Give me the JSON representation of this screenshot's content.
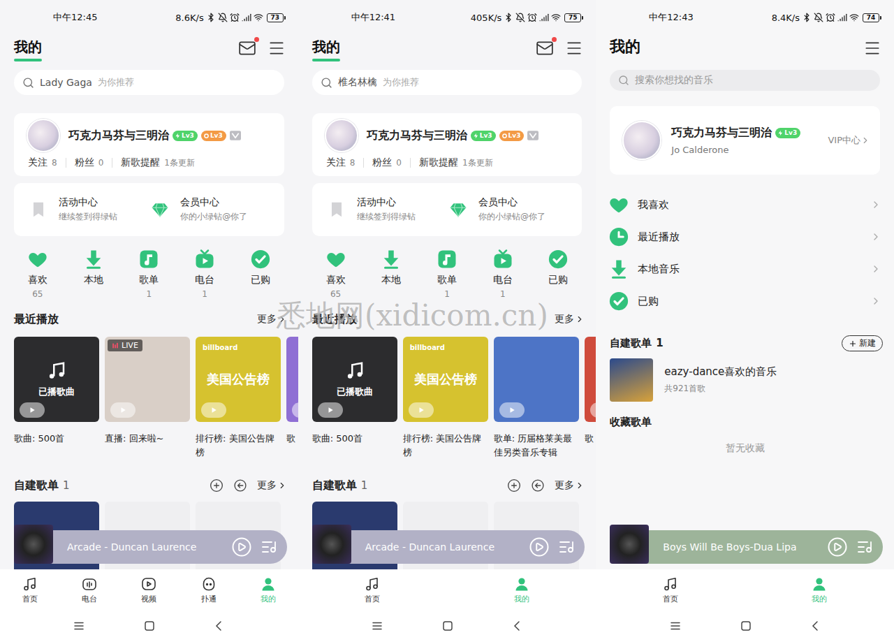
{
  "watermark": "悉地网(xidicom.cn)",
  "phones": [
    {
      "kind": "classic",
      "status": {
        "time": "中午12:45",
        "speed": "8.6K/s",
        "battery": "73"
      },
      "header": {
        "title": "我的",
        "mail_unread": true
      },
      "search": {
        "placeholder": "Lady Gaga",
        "hint": "为你推荐"
      },
      "profile": {
        "name": "巧克力马芬与三明治",
        "badges": [
          {
            "label": "Lv3",
            "color": "#4fd36a"
          },
          {
            "label": "Lv3",
            "color": "#f39a45"
          }
        ],
        "stats": [
          {
            "label": "关注",
            "value": "8"
          },
          {
            "label": "粉丝",
            "value": "0"
          },
          {
            "label": "新歌提醒",
            "value": "1条更新"
          }
        ]
      },
      "promos": [
        {
          "kind": "activity",
          "title": "活动中心",
          "subtitle": "继续签到得绿钻"
        },
        {
          "kind": "vip",
          "title": "会员中心",
          "subtitle": "你的小绿钻@你了"
        }
      ],
      "shortcuts": [
        {
          "kind": "like",
          "label": "喜欢",
          "count": "65"
        },
        {
          "kind": "local",
          "label": "本地"
        },
        {
          "kind": "playlist",
          "label": "歌单",
          "count": "1"
        },
        {
          "kind": "radio",
          "label": "电台",
          "count": "1"
        },
        {
          "kind": "bought",
          "label": "已购"
        }
      ],
      "recent": {
        "title": "最近播放",
        "more": "更多",
        "items": [
          {
            "kind": "played",
            "cover_text": "已播歌曲",
            "caption": "歌曲: 500首",
            "color": "#2c2c2e"
          },
          {
            "kind": "live",
            "badge": "LIVE",
            "caption": "直播: 回来啦~",
            "color": "#d9cfc7"
          },
          {
            "kind": "chart",
            "brand": "billboard",
            "cover_text": "美国公告榜",
            "caption": "排行榜: 美国公告牌榜",
            "color": "#d6c22f"
          },
          {
            "kind": "photo",
            "caption": "歌",
            "color": "#8f6fd4"
          }
        ]
      },
      "playlists": {
        "title": "自建歌单",
        "count": "1",
        "more": "更多",
        "covers": [
          {
            "color": "#2a3a6e"
          },
          {
            "color": "#efeff1"
          },
          {
            "color": "#efeff1"
          }
        ]
      },
      "player": {
        "track": "Arcade - Duncan Laurence",
        "color": "#b2b1c6"
      },
      "nav": [
        {
          "kind": "home",
          "label": "首页",
          "selected": false
        },
        {
          "kind": "radio",
          "label": "电台",
          "selected": false
        },
        {
          "kind": "video",
          "label": "视频",
          "selected": false
        },
        {
          "kind": "social",
          "label": "扑通",
          "selected": false
        },
        {
          "kind": "me",
          "label": "我的",
          "selected": true
        }
      ]
    },
    {
      "kind": "classic",
      "status": {
        "time": "中午12:41",
        "speed": "405K/s",
        "battery": "75"
      },
      "header": {
        "title": "我的",
        "mail_unread": true
      },
      "search": {
        "placeholder": "椎名林檎",
        "hint": "为你推荐"
      },
      "profile": {
        "name": "巧克力马芬与三明治",
        "badges": [
          {
            "label": "Lv3",
            "color": "#4fd36a"
          },
          {
            "label": "Lv3",
            "color": "#f39a45"
          }
        ],
        "stats": [
          {
            "label": "关注",
            "value": "8"
          },
          {
            "label": "粉丝",
            "value": "0"
          },
          {
            "label": "新歌提醒",
            "value": "1条更新"
          }
        ]
      },
      "promos": [
        {
          "kind": "activity",
          "title": "活动中心",
          "subtitle": "继续签到得绿钻"
        },
        {
          "kind": "vip",
          "title": "会员中心",
          "subtitle": "你的小绿钻@你了"
        }
      ],
      "shortcuts": [
        {
          "kind": "like",
          "label": "喜欢",
          "count": "65"
        },
        {
          "kind": "local",
          "label": "本地"
        },
        {
          "kind": "playlist",
          "label": "歌单",
          "count": "1"
        },
        {
          "kind": "radio",
          "label": "电台",
          "count": "1"
        },
        {
          "kind": "bought",
          "label": "已购"
        }
      ],
      "recent": {
        "title": "最近播放",
        "more": "更多",
        "items": [
          {
            "kind": "played",
            "cover_text": "已播歌曲",
            "caption": "歌曲: 500首",
            "color": "#2c2c2e"
          },
          {
            "kind": "chart",
            "brand": "billboard",
            "cover_text": "美国公告榜",
            "caption": "排行榜: 美国公告牌榜",
            "color": "#d6c22f"
          },
          {
            "kind": "photo",
            "caption": "歌单: 历届格莱美最佳另类音乐专辑",
            "color": "#4d74c6"
          },
          {
            "kind": "photo",
            "caption": "歌",
            "color": "#cf4b3c"
          }
        ]
      },
      "playlists": {
        "title": "自建歌单",
        "count": "1",
        "more": "更多",
        "covers": [
          {
            "color": "#2a3a6e"
          },
          {
            "color": "#efeff1"
          },
          {
            "color": "#efeff1"
          }
        ]
      },
      "player": {
        "track": "Arcade - Duncan Laurence",
        "color": "#b2b1c6"
      },
      "nav": [
        {
          "kind": "home",
          "label": "首页",
          "selected": false
        },
        {
          "kind": "me",
          "label": "我的",
          "selected": true
        }
      ]
    },
    {
      "kind": "simple",
      "status": {
        "time": "中午12:43",
        "speed": "8.4K/s",
        "battery": "74"
      },
      "header": {
        "title": "我的"
      },
      "search": {
        "placeholder": "搜索你想找的音乐"
      },
      "profile": {
        "name": "巧克力马芬与三明治",
        "badges": [
          {
            "label": "Lv3",
            "color": "#4fd36a"
          }
        ],
        "subtitle": "Jo Calderone",
        "link": "VIP中心"
      },
      "menu": [
        {
          "kind": "like",
          "label": "我喜欢"
        },
        {
          "kind": "recent",
          "label": "最近播放"
        },
        {
          "kind": "local",
          "label": "本地音乐"
        },
        {
          "kind": "bought",
          "label": "已购"
        }
      ],
      "playlists": {
        "title": "自建歌单",
        "count": "1",
        "action": "新建",
        "items": [
          {
            "name": "eazy-dance喜欢的音乐",
            "meta": "共921首歌",
            "color": "#2b4a8c"
          }
        ]
      },
      "favorites": {
        "title": "收藏歌单",
        "empty": "暂无收藏"
      },
      "player": {
        "track": "Boys Will Be Boys-Dua Lipa",
        "color": "#9db49a"
      },
      "nav": [
        {
          "kind": "home",
          "label": "首页",
          "selected": false
        },
        {
          "kind": "me",
          "label": "我的",
          "selected": true
        }
      ]
    }
  ]
}
